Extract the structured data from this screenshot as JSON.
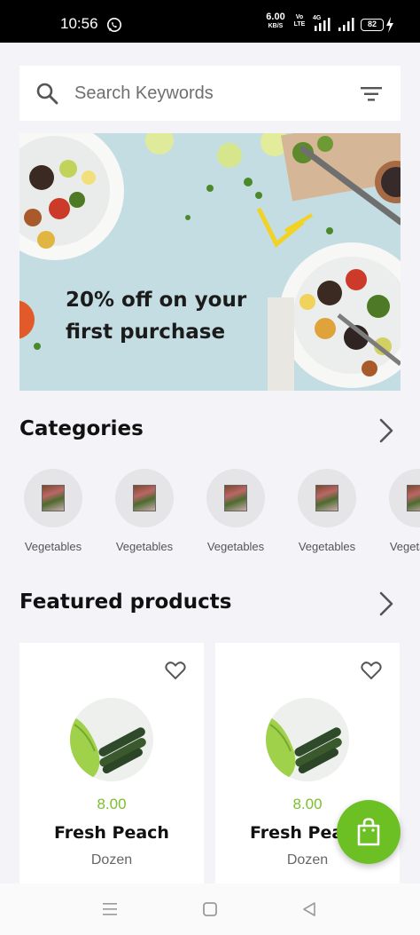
{
  "status_bar": {
    "time": "10:56",
    "net_speed_value": "6.00",
    "net_speed_unit": "KB/S",
    "volte_top": "Vo",
    "volte_bottom": "LTE",
    "network_type": "4G",
    "battery": "82",
    "icons": [
      "whatsapp-icon",
      "signal-icon",
      "battery-icon",
      "charging-icon"
    ]
  },
  "search": {
    "placeholder": "Search Keywords",
    "value": ""
  },
  "banner": {
    "text_line1": "20% off on your",
    "text_line2": "first purchase"
  },
  "categories": {
    "title": "Categories",
    "items": [
      {
        "label": "Vegetables"
      },
      {
        "label": "Vegetables"
      },
      {
        "label": "Vegetables"
      },
      {
        "label": "Vegetables"
      },
      {
        "label": "Vegetables"
      }
    ]
  },
  "featured": {
    "title": "Featured products",
    "products": [
      {
        "price": "8.00",
        "name": "Fresh Peach",
        "unit": "Dozen"
      },
      {
        "price": "8.00",
        "name": "Fresh Peach",
        "unit": "Dozen"
      }
    ]
  },
  "colors": {
    "accent_green": "#6cc024",
    "price_green": "#7bbf2c",
    "background": "#f4f4f8"
  }
}
